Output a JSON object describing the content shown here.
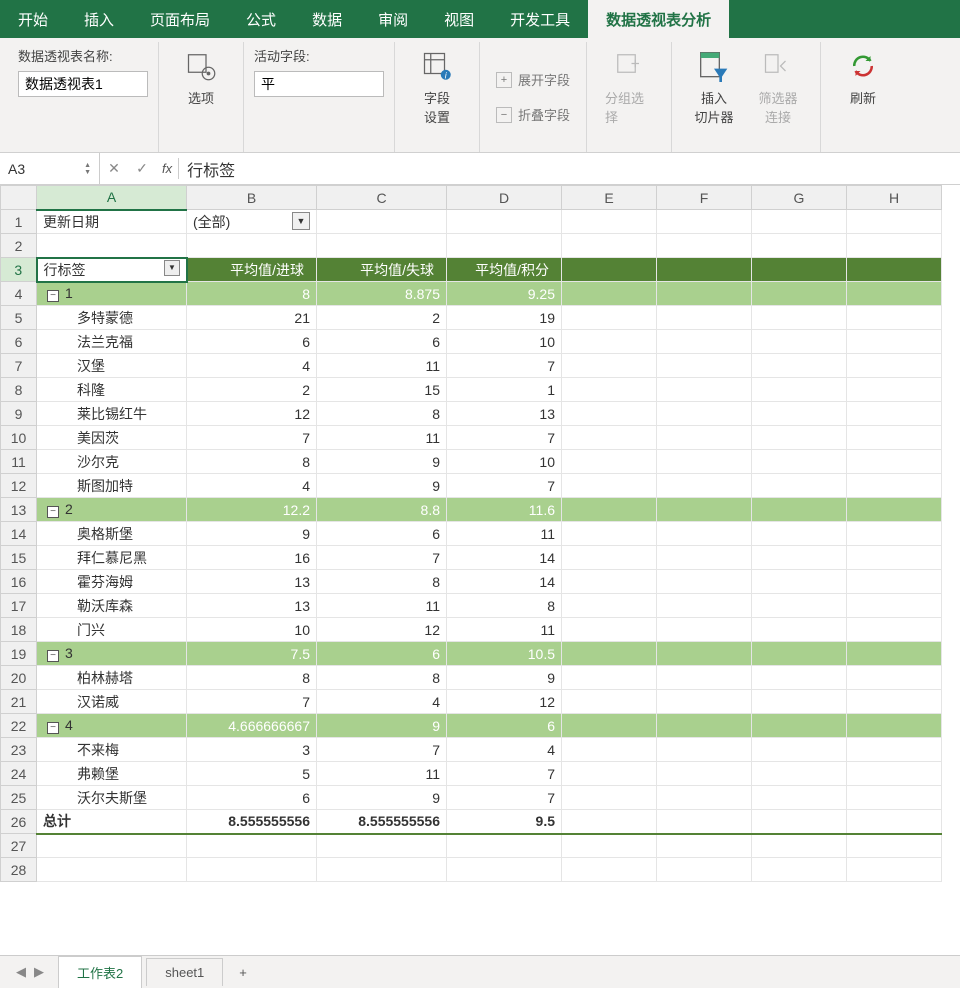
{
  "ribbon": {
    "tabs": [
      "开始",
      "插入",
      "页面布局",
      "公式",
      "数据",
      "审阅",
      "视图",
      "开发工具",
      "数据透视表分析"
    ],
    "active_tab": 8,
    "pt_name_label": "数据透视表名称:",
    "pt_name_value": "数据透视表1",
    "options_label": "选项",
    "active_field_label": "活动字段:",
    "active_field_value": "平",
    "field_settings": "字段\n设置",
    "expand_field": "展开字段",
    "collapse_field": "折叠字段",
    "group_select": "分组选择",
    "insert_slicer": "插入\n切片器",
    "filter_conn": "筛选器\n连接",
    "refresh": "刷新"
  },
  "formula_bar": {
    "name_box": "A3",
    "fx": "fx",
    "value": "行标签"
  },
  "columns": [
    "A",
    "B",
    "C",
    "D",
    "E",
    "F",
    "G",
    "H"
  ],
  "row_numbers": [
    "1",
    "2",
    "3",
    "4",
    "5",
    "6",
    "7",
    "8",
    "9",
    "10",
    "11",
    "12",
    "13",
    "14",
    "15",
    "16",
    "17",
    "18",
    "19",
    "20",
    "21",
    "22",
    "23",
    "24",
    "25",
    "26",
    "27",
    "28"
  ],
  "cells": {
    "r1": {
      "a": "更新日期",
      "b": "(全部)"
    },
    "r3": {
      "a": "行标签",
      "b": "平均值/进球",
      "c": "平均值/失球",
      "d": "平均值/积分"
    },
    "r4": {
      "a": "1",
      "b": "8",
      "c": "8.875",
      "d": "9.25"
    },
    "r5": {
      "a": "多特蒙德",
      "b": "21",
      "c": "2",
      "d": "19"
    },
    "r6": {
      "a": "法兰克福",
      "b": "6",
      "c": "6",
      "d": "10"
    },
    "r7": {
      "a": "汉堡",
      "b": "4",
      "c": "11",
      "d": "7"
    },
    "r8": {
      "a": "科隆",
      "b": "2",
      "c": "15",
      "d": "1"
    },
    "r9": {
      "a": "莱比锡红牛",
      "b": "12",
      "c": "8",
      "d": "13"
    },
    "r10": {
      "a": "美因茨",
      "b": "7",
      "c": "11",
      "d": "7"
    },
    "r11": {
      "a": "沙尔克",
      "b": "8",
      "c": "9",
      "d": "10"
    },
    "r12": {
      "a": "斯图加特",
      "b": "4",
      "c": "9",
      "d": "7"
    },
    "r13": {
      "a": "2",
      "b": "12.2",
      "c": "8.8",
      "d": "11.6"
    },
    "r14": {
      "a": "奥格斯堡",
      "b": "9",
      "c": "6",
      "d": "11"
    },
    "r15": {
      "a": "拜仁慕尼黑",
      "b": "16",
      "c": "7",
      "d": "14"
    },
    "r16": {
      "a": "霍芬海姆",
      "b": "13",
      "c": "8",
      "d": "14"
    },
    "r17": {
      "a": "勒沃库森",
      "b": "13",
      "c": "11",
      "d": "8"
    },
    "r18": {
      "a": "门兴",
      "b": "10",
      "c": "12",
      "d": "11"
    },
    "r19": {
      "a": "3",
      "b": "7.5",
      "c": "6",
      "d": "10.5"
    },
    "r20": {
      "a": "柏林赫塔",
      "b": "8",
      "c": "8",
      "d": "9"
    },
    "r21": {
      "a": "汉诺威",
      "b": "7",
      "c": "4",
      "d": "12"
    },
    "r22": {
      "a": "4",
      "b": "4.666666667",
      "c": "9",
      "d": "6"
    },
    "r23": {
      "a": "不来梅",
      "b": "3",
      "c": "7",
      "d": "4"
    },
    "r24": {
      "a": "弗赖堡",
      "b": "5",
      "c": "11",
      "d": "7"
    },
    "r25": {
      "a": "沃尔夫斯堡",
      "b": "6",
      "c": "9",
      "d": "7"
    },
    "r26": {
      "a": "总计",
      "b": "8.555555556",
      "c": "8.555555556",
      "d": "9.5"
    }
  },
  "sheets": {
    "active": "工作表2",
    "other": "sheet1",
    "add": "+"
  }
}
